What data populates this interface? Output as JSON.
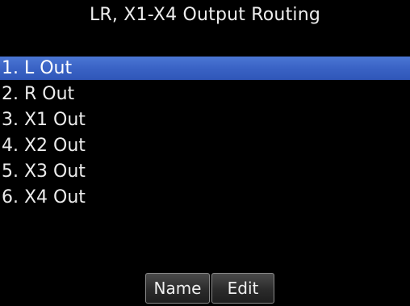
{
  "screen": {
    "title": "LR, X1-X4 Output Routing"
  },
  "outputs": [
    {
      "label": "1. L Out",
      "selected": true
    },
    {
      "label": "2. R Out",
      "selected": false
    },
    {
      "label": "3. X1 Out",
      "selected": false
    },
    {
      "label": "4. X2 Out",
      "selected": false
    },
    {
      "label": "5. X3 Out",
      "selected": false
    },
    {
      "label": "6. X4 Out",
      "selected": false
    }
  ],
  "softkeys": {
    "name_label": "Name",
    "edit_label": "Edit"
  },
  "colors": {
    "background": "#000000",
    "selection": "#3a63c5",
    "text": "#ececec"
  }
}
